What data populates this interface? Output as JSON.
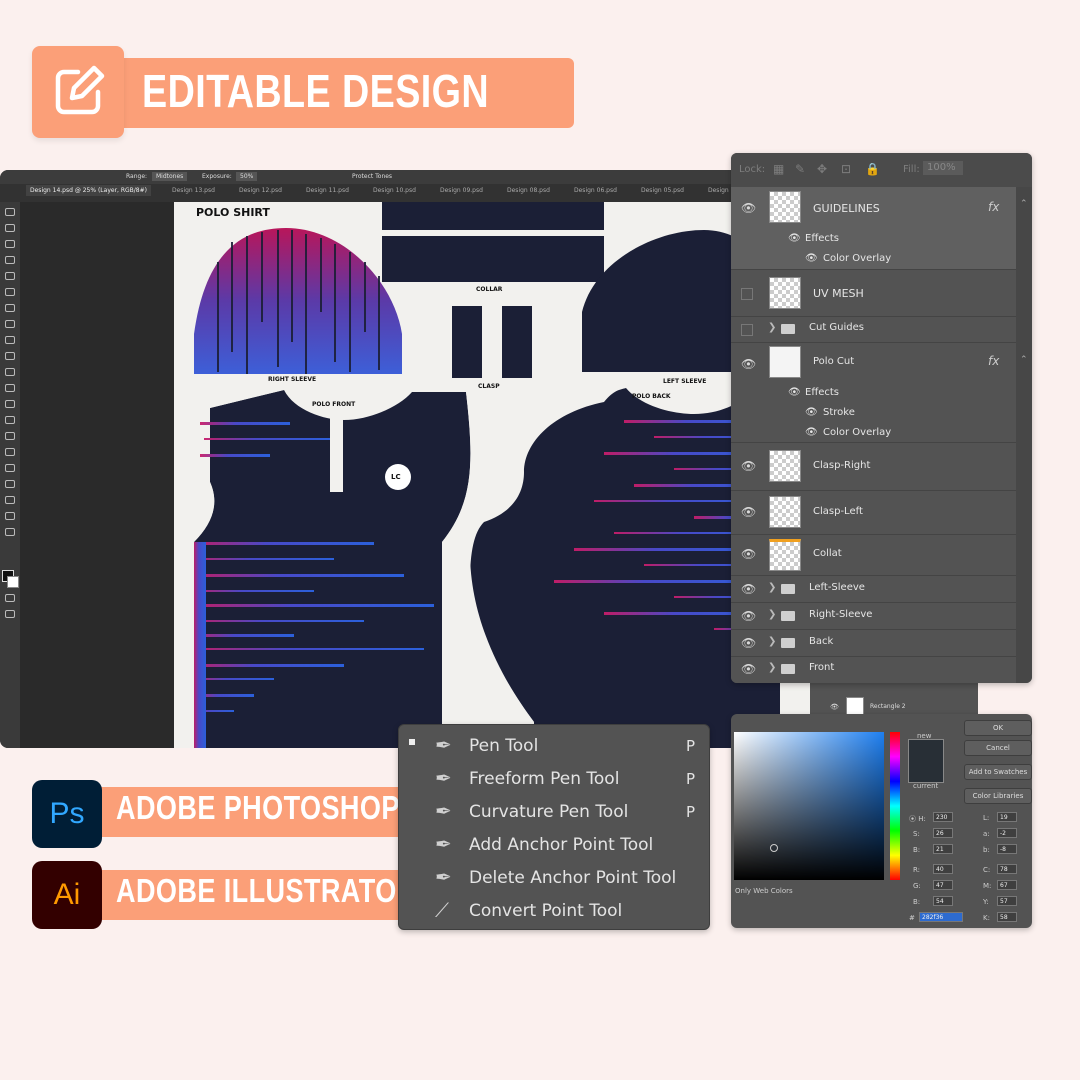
{
  "header": {
    "title": "EDITABLE DESIGN",
    "icon": "edit-icon"
  },
  "photoshop_window": {
    "options": {
      "range_label": "Range:",
      "range_value": "Midtones",
      "exposure_label": "Exposure:",
      "exposure_value": "50%",
      "protect_tones": "Protect Tones"
    },
    "tabs": [
      "Design 14.psd @ 25% (Layer, RGB/8#)",
      "Design 13.psd",
      "Design 12.psd",
      "Design 11.psd",
      "Design 10.psd",
      "Design 09.psd",
      "Design 08.psd",
      "Design 06.psd",
      "Design 05.psd",
      "Design"
    ],
    "canvas": {
      "title": "POLO SHIRT",
      "labels": {
        "collar": "COLLAR",
        "clasp": "CLASP",
        "right_sleeve": "RIGHT SLEEVE",
        "left_sleeve": "LEFT SLEEVE",
        "polo_front": "POLO FRONT",
        "polo_back": "POLO BACK",
        "logo": "LC"
      }
    }
  },
  "layers_panel": {
    "lock_label": "Lock:",
    "fill_label": "Fill:",
    "fill_value": "100%",
    "rows": {
      "guidelines": "GUIDELINES",
      "guidelines_effects": "Effects",
      "guidelines_color_overlay": "Color Overlay",
      "uv_mesh": "UV MESH",
      "cut_guides": "Cut Guides",
      "polo_cut": "Polo Cut",
      "polo_cut_effects": "Effects",
      "polo_cut_stroke": "Stroke",
      "polo_cut_color_overlay": "Color Overlay",
      "clasp_right": "Clasp-Right",
      "clasp_left": "Clasp-Left",
      "collar": "Collat",
      "left_sleeve": "Left-Sleeve",
      "right_sleeve": "Right-Sleeve",
      "back": "Back",
      "front": "Front"
    },
    "fx_symbol": "fx",
    "behind_panel_layer": "Rectangle 2"
  },
  "pen_menu": {
    "items": [
      {
        "label": "Pen Tool",
        "shortcut": "P",
        "icon": "pen-icon"
      },
      {
        "label": "Freeform Pen Tool",
        "shortcut": "P",
        "icon": "freeform-pen-icon"
      },
      {
        "label": "Curvature Pen Tool",
        "shortcut": "P",
        "icon": "curvature-pen-icon"
      },
      {
        "label": "Add Anchor Point Tool",
        "shortcut": "",
        "icon": "add-anchor-icon"
      },
      {
        "label": "Delete Anchor Point Tool",
        "shortcut": "",
        "icon": "delete-anchor-icon"
      },
      {
        "label": "Convert Point Tool",
        "shortcut": "",
        "icon": "convert-point-icon"
      }
    ]
  },
  "color_picker": {
    "new_label": "new",
    "current_label": "current",
    "ok": "OK",
    "cancel": "Cancel",
    "add_to_swatches": "Add to Swatches",
    "color_libraries": "Color Libraries",
    "only_web_colors": "Only Web Colors",
    "fields": {
      "h": "230",
      "s": "26",
      "b": "21",
      "r": "40",
      "g": "47",
      "b2": "54",
      "l": "19",
      "a": "-2",
      "bb": "-8",
      "c": "78",
      "m": "67",
      "y": "57",
      "k": "58"
    },
    "hex": "282f36",
    "swatch_color": "#282f36"
  },
  "apps": [
    {
      "name": "ADOBE PHOTOSHOP",
      "logo": "Ps"
    },
    {
      "name": "ADOBE ILLUSTRATOR",
      "logo": "Ai"
    }
  ],
  "colors": {
    "accent": "#fb9f78",
    "background": "#fbf0ee",
    "navy": "#1b1f36"
  }
}
